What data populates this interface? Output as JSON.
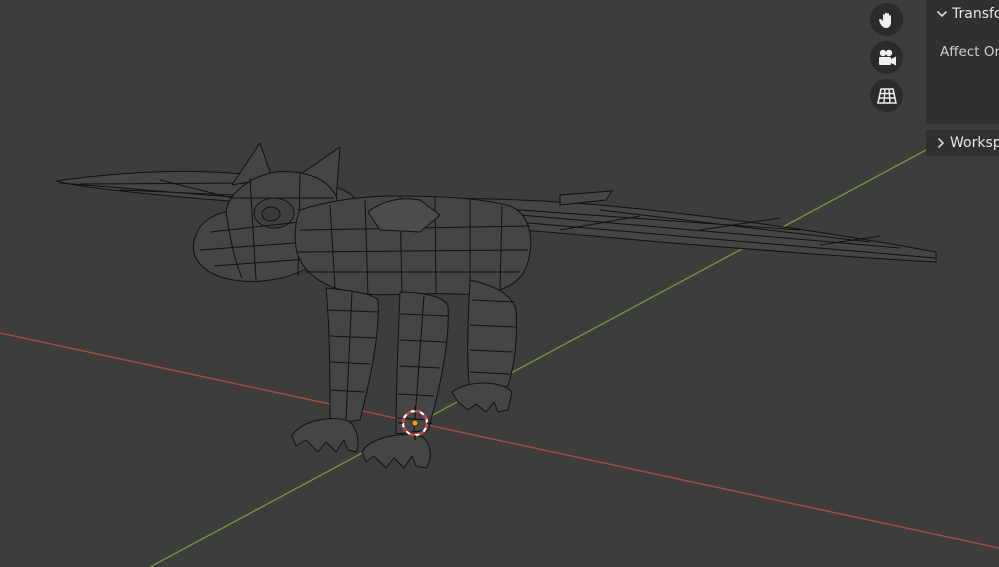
{
  "viewport": {
    "background": "#3d3d3d",
    "x_axis_color": "#b34848",
    "y_axis_color": "#6e9a3c",
    "mesh_wire_color": "#111111",
    "mesh_fill_color": "#4a4a4a",
    "cursor_color": "#d23b3b",
    "origin_dot_color": "#ff9a1a",
    "model": "winged-creature-wireframe-mesh"
  },
  "navigation_gizmo": {
    "buttons": [
      {
        "name": "pan-view",
        "icon": "hand-icon"
      },
      {
        "name": "camera-view",
        "icon": "camera-icon"
      },
      {
        "name": "perspective-toggle",
        "icon": "grid-perspective-icon"
      }
    ]
  },
  "side_panel": {
    "transform": {
      "header": "Transform",
      "expanded": true,
      "affect_only_label": "Affect Only"
    },
    "workspace": {
      "header": "Workspace",
      "expanded": false
    }
  }
}
